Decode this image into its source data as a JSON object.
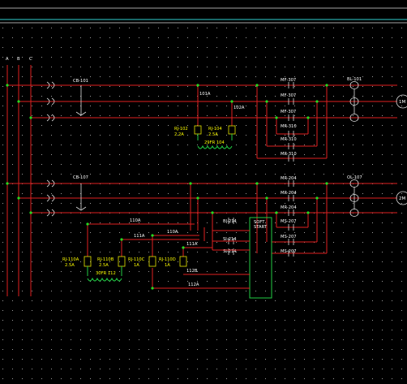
{
  "phases": [
    "A",
    "B",
    "C"
  ],
  "upper": {
    "breaker": "CB-101",
    "breaker_right": "BL-101",
    "wire_101": "101A",
    "wire_102": "102A",
    "relays": [
      {
        "name": "RJ-102",
        "rating": "2.2A"
      },
      {
        "name": "RJ-104",
        "rating": "2.5A"
      }
    ],
    "fr": "29FR 104",
    "contacts": [
      "MF-307",
      "MF-307",
      "MF-307",
      "MR-310",
      "MR-310",
      "MR-310"
    ],
    "motor": "1M"
  },
  "lower": {
    "breaker": "CB-107",
    "breaker_right": "OL-107",
    "contacts": [
      "MR-204",
      "MR-204",
      "MR-204",
      "MS-207",
      "MS-207",
      "MS-207"
    ],
    "bl": [
      "BI-214",
      "SI-214",
      "SI-214"
    ],
    "soft_start": [
      "SOFT",
      "START"
    ],
    "wires": [
      "110A",
      "111A",
      "110A",
      "111A",
      "112B",
      "112A"
    ],
    "relays": [
      {
        "name": "RJ-110A",
        "rating": "2.5A"
      },
      {
        "name": "RJ-110B",
        "rating": "2.5A"
      },
      {
        "name": "RJ-110C",
        "rating": "1A"
      },
      {
        "name": "RJ-110D",
        "rating": "1A"
      }
    ],
    "fr": "30FR 112",
    "motor": "2M"
  },
  "colors": {
    "background": "#000000",
    "bus": "#e02020",
    "control": "#22cc44",
    "labels": "#ffffff",
    "relays": "#ffff00",
    "frame": "#30d0d0"
  }
}
